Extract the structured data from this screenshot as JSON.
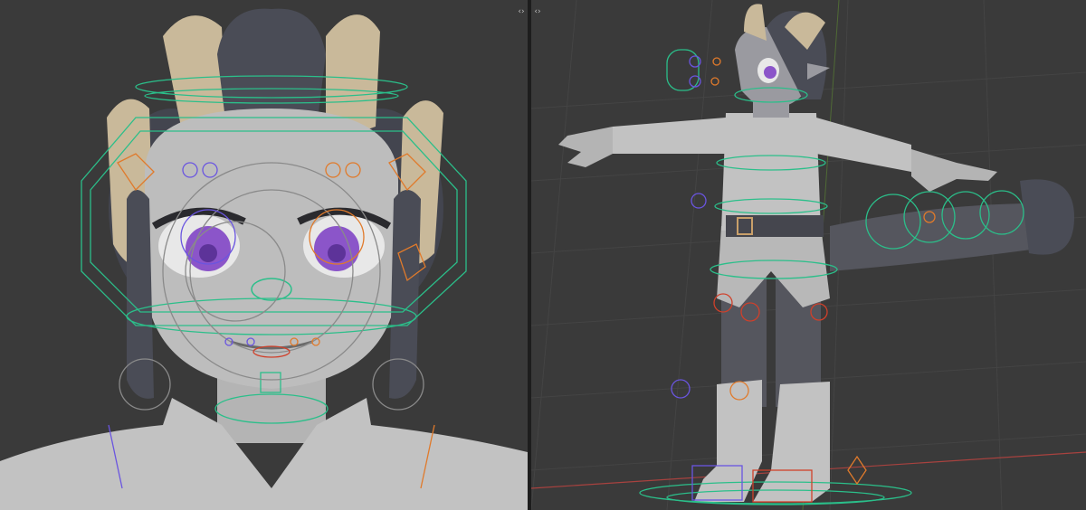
{
  "layout": "split-viewport",
  "panes": {
    "left": {
      "view": "character-head-closeup",
      "collapse_glyph": "‹›"
    },
    "right": {
      "view": "character-full-body-tpose",
      "collapse_glyph": "‹›"
    }
  },
  "colors": {
    "viewport_bg": "#3a3a3a",
    "split_bar": "#1d1d1d",
    "mesh_grey": "#bdbdbd",
    "mesh_dark": "#4a4c56",
    "horn": "#c9b99a",
    "eye": "#8b55c9",
    "control_green": "#2bbf8a",
    "control_orange": "#e07a2b",
    "control_purple": "#6a55e0",
    "control_red": "#d0402a",
    "grid_line": "#444444",
    "axis_red": "#a8423f",
    "axis_green": "#5e8a33"
  },
  "icons": {
    "corner_left": "area-split-icon",
    "corner_right": "area-split-icon"
  }
}
